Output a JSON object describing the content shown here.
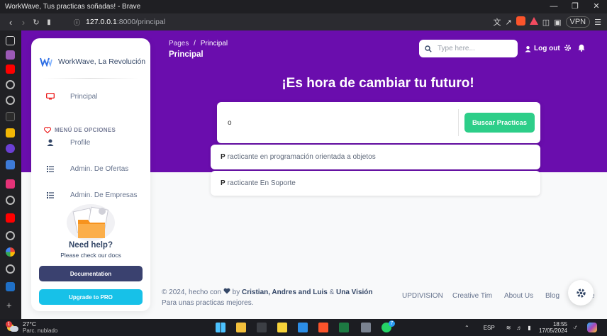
{
  "browser": {
    "window_title": "WorkWave, Tus practicas soñadas! - Brave",
    "url_host": "127.0.0.1",
    "url_rest": ":8000/principal",
    "vpn_label": "VPN"
  },
  "sidebar": {
    "brand": "WorkWave, La Revolución",
    "items": [
      {
        "label": "Principal",
        "icon": "monitor-icon"
      },
      {
        "label": "Profile",
        "icon": "user-icon"
      },
      {
        "label": "Admin. De Ofertas",
        "icon": "list-icon"
      },
      {
        "label": "Admin. De Empresas",
        "icon": "list-icon"
      }
    ],
    "section_title": "MENÚ DE OPCIONES",
    "help_title": "Need help?",
    "help_sub": "Please check our docs",
    "doc_button": "Documentation",
    "pro_button": "Upgrade to PRO"
  },
  "header": {
    "breadcrumb_parent": "Pages",
    "breadcrumb_sep": "/",
    "breadcrumb_current": "Principal",
    "title": "Principal",
    "search_placeholder": "Type here...",
    "logout_label": "Log out"
  },
  "main": {
    "heading": "¡Es hora de cambiar tu futuro!",
    "search_value": "o",
    "search_button": "Buscar Practicas",
    "suggestions": [
      {
        "first": "P",
        "rest": "racticante en programación orientada a objetos"
      },
      {
        "first": "P",
        "rest": "racticante En Soporte"
      }
    ]
  },
  "footer": {
    "text_prefix": "© 2024, hecho con",
    "text_by": "by",
    "authors": "Cristian, Andres and Luis",
    "amp": "&",
    "vision": "Una Visión",
    "text_suffix": "Para unas practicas mejores.",
    "links": [
      "UPDIVISION",
      "Creative Tim",
      "About Us",
      "Blog",
      "e"
    ]
  },
  "taskbar": {
    "temp": "27°C",
    "weather": "Parc. nublado",
    "lang": "ESP",
    "time": "18:55",
    "date": "17/05/2024",
    "whatsapp_badge": "7",
    "weather_badge": "1"
  },
  "colors": {
    "hero": "#6a0dad",
    "accent_green": "#2dce89",
    "doc_button": "#3a416f",
    "pro_button": "#17c1e8",
    "active_item": "#ea0606"
  }
}
